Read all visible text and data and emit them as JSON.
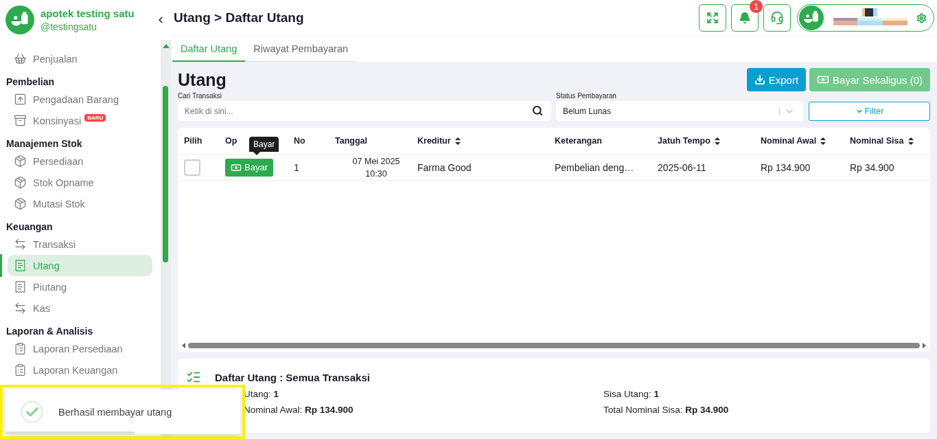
{
  "brand": {
    "name": "apotek testing satu",
    "handle": "@testingsatu"
  },
  "sidebar": {
    "items": [
      {
        "kind": "item",
        "label": "Penjualan",
        "selected": false
      },
      {
        "kind": "heading",
        "label": "Pembelian"
      },
      {
        "kind": "item",
        "label": "Pengadaan Barang",
        "selected": false
      },
      {
        "kind": "item",
        "label": "Konsinyasi",
        "selected": false,
        "badge": "BARU"
      },
      {
        "kind": "heading",
        "label": "Manajemen Stok"
      },
      {
        "kind": "item",
        "label": "Persediaan",
        "selected": false
      },
      {
        "kind": "item",
        "label": "Stok Opname",
        "selected": false
      },
      {
        "kind": "item",
        "label": "Mutasi Stok",
        "selected": false
      },
      {
        "kind": "heading",
        "label": "Keuangan"
      },
      {
        "kind": "item",
        "label": "Transaksi",
        "selected": false
      },
      {
        "kind": "item",
        "label": "Utang",
        "selected": true
      },
      {
        "kind": "item",
        "label": "Piutang",
        "selected": false
      },
      {
        "kind": "item",
        "label": "Kas",
        "selected": false
      },
      {
        "kind": "heading",
        "label": "Laporan & Analisis"
      },
      {
        "kind": "item",
        "label": "Laporan Persediaan",
        "selected": false
      },
      {
        "kind": "item",
        "label": "Laporan Keuangan",
        "selected": false
      }
    ]
  },
  "header": {
    "breadcrumb": "Utang > Daftar Utang",
    "notification_count": "1"
  },
  "tabs": [
    {
      "label": "Daftar Utang",
      "selected": true
    },
    {
      "label": "Riwayat Pembayaran",
      "selected": false
    }
  ],
  "page_title": "Utang",
  "actions": [
    {
      "kind": "export",
      "label": "Export",
      "disabled": false
    },
    {
      "kind": "pay",
      "label": "Bayar Sekaligus (0)",
      "disabled": true
    }
  ],
  "search": {
    "label": "Cari Transaksi",
    "placeholder": "Ketik di sini..."
  },
  "status": {
    "label": "Status Pembayaran",
    "value": "Belum Lunas"
  },
  "filter_button": "Filter",
  "table": {
    "columns": [
      {
        "label": "Pilih",
        "sortable": false
      },
      {
        "label": "Op",
        "sortable": false
      },
      {
        "label": "No",
        "sortable": false
      },
      {
        "label": "Tanggal",
        "sortable": false
      },
      {
        "label": "Kreditur",
        "sortable": true
      },
      {
        "label": "Keterangan",
        "sortable": false
      },
      {
        "label": "Jatuh Tempo",
        "sortable": true
      },
      {
        "label": "Nominal Awal",
        "sortable": true
      },
      {
        "label": "Nominal Sisa",
        "sortable": true
      }
    ],
    "rows": [
      {
        "checked": false,
        "action": "Bayar",
        "no": "1",
        "date": "07 Mei 2025",
        "time": "10:30",
        "kreditur": "Farma Good",
        "keterangan": "Pembelian deng…",
        "jatuh_tempo": "2025-06-11",
        "nominal_awal": "Rp 134.900",
        "nominal_sisa": "Rp 34.900"
      }
    ],
    "tooltip": "Bayar"
  },
  "summary": {
    "title": "Daftar Utang : Semua Transaksi",
    "stats": [
      "Utang: **1**",
      "Sisa Utang: **1**",
      "Nominal Awal: **Rp 134.900**",
      "Total Nominal Sisa: **Rp 34.900**"
    ]
  },
  "toast": {
    "message": "Berhasil membayar utang",
    "level": 0.55
  }
}
